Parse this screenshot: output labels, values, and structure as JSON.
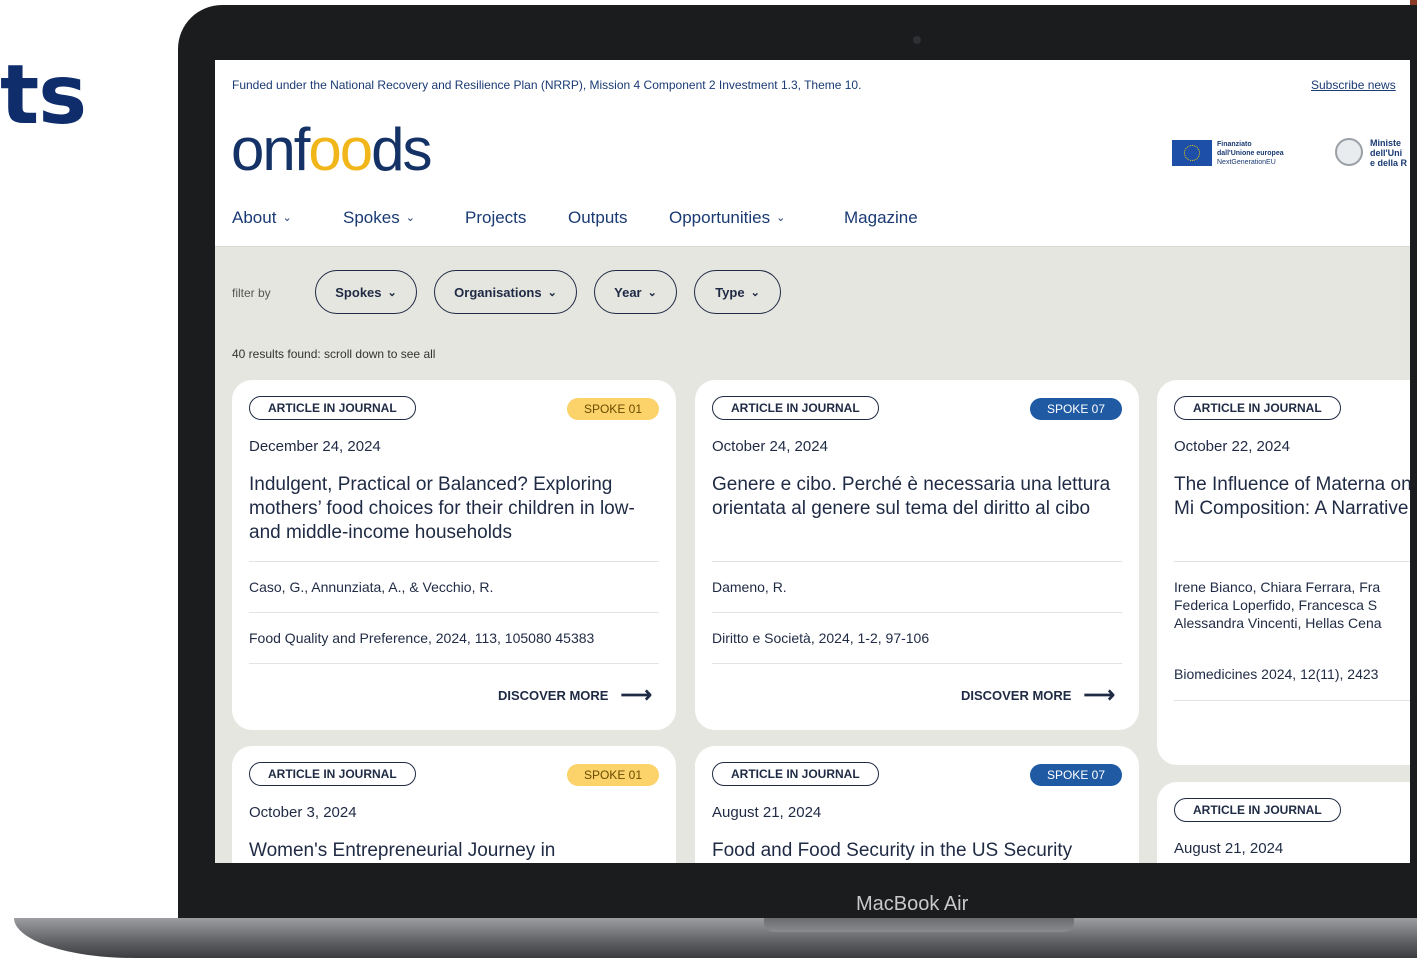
{
  "slide": {
    "title_fragment": "ts"
  },
  "device": {
    "label": "MacBook Air"
  },
  "topbar": {
    "funding_text": "Funded under the National Recovery and Resilience Plan (NRRP), Mission 4 Component 2 Investment 1.3, Theme 10.",
    "subscribe_link": "Subscribe news"
  },
  "header": {
    "logo_text": {
      "pre": "onf",
      "mid": "oo",
      "post": "ds"
    },
    "eu_logo": {
      "line1": "Finanziato",
      "line2": "dall'Unione europea",
      "line3": "NextGenerationEU"
    },
    "ministry_logo": {
      "line1": "Ministe",
      "line2": "dell'Uni",
      "line3": "e della R"
    }
  },
  "nav": [
    {
      "label": "About",
      "has_dropdown": true
    },
    {
      "label": "Spokes",
      "has_dropdown": true
    },
    {
      "label": "Projects",
      "has_dropdown": false
    },
    {
      "label": "Outputs",
      "has_dropdown": false
    },
    {
      "label": "Opportunities",
      "has_dropdown": true
    },
    {
      "label": "Magazine",
      "has_dropdown": false
    }
  ],
  "filters": {
    "label": "filter by",
    "pills": [
      "Spokes",
      "Organisations",
      "Year",
      "Type"
    ],
    "results_text": "40 results found: scroll down to see all"
  },
  "icons": {
    "chevron": "chevron-down-icon",
    "arrow": "arrow-right-icon"
  },
  "colors": {
    "navy": "#1a3a73",
    "logo_accent": "#f1b71a",
    "spoke_yellow": "#fbd36a",
    "spoke_blue": "#1f5aa3",
    "page_bg": "#e6e6e0"
  },
  "cards": [
    {
      "type": "ARTICLE IN JOURNAL",
      "spoke": "SPOKE 01",
      "spoke_color": "yellow",
      "date": "December 24, 2024",
      "title": "Indulgent, Practical or Balanced? Exploring mothers’ food choices for their children in low-and middle-income households",
      "authors": "Caso, G., Annunziata, A., & Vecchio, R.",
      "source": "Food Quality and Preference, 2024, 113, 105080 45383",
      "cta": "DISCOVER MORE"
    },
    {
      "type": "ARTICLE IN JOURNAL",
      "spoke": "SPOKE 07",
      "spoke_color": "blue",
      "date": "October 24, 2024",
      "title": "Genere e cibo. Perché è necessaria una lettura orientata al genere sul tema del diritto al cibo",
      "authors": "Dameno, R.",
      "source": "Diritto e Società, 2024, 1-2, 97-106",
      "cta": "DISCOVER MORE"
    },
    {
      "type": "ARTICLE IN JOURNAL",
      "date": "October 22, 2024",
      "title": "The Influence of Materna on Human Breast Milk Mi Composition: A Narrative",
      "authors": "Irene Bianco, Chiara Ferrara, Fra Federica Loperfido, Francesca S Alessandra Vincenti, Hellas Cena",
      "source": "Biomedicines 2024, 12(11), 2423"
    },
    {
      "type": "ARTICLE IN JOURNAL",
      "spoke": "SPOKE 01",
      "spoke_color": "yellow",
      "date": "October 3, 2024",
      "title": "Women's Entrepreneurial Journey in"
    },
    {
      "type": "ARTICLE IN JOURNAL",
      "spoke": "SPOKE 07",
      "spoke_color": "blue",
      "date": "August 21, 2024",
      "title": "Food and Food Security in the US Security"
    },
    {
      "type": "ARTICLE IN JOURNAL",
      "date": "August 21, 2024"
    }
  ]
}
